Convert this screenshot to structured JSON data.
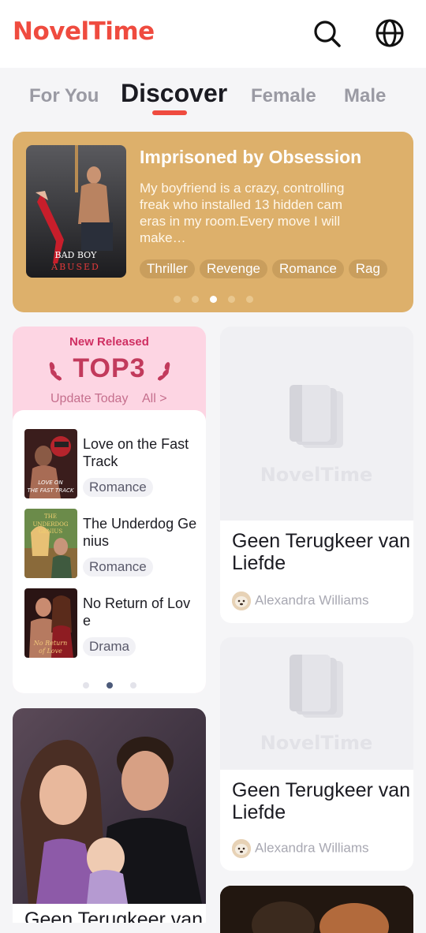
{
  "header": {
    "logo": "NovelTime",
    "search_icon": "search-icon",
    "language_icon": "globe-icon"
  },
  "tabs": [
    {
      "label": "For You"
    },
    {
      "label": "Discover"
    },
    {
      "label": "Female"
    },
    {
      "label": "Male"
    }
  ],
  "banner": {
    "title": "Imprisoned by Obsession",
    "description": "My boyfriend is a crazy, controlling freak who installed 13 hidden cam eras in my room.Every move I will make…",
    "cover_text_1": "BAD BOY",
    "cover_text_2": "ABUSED",
    "tags": [
      "Thriller",
      "Revenge",
      "Romance",
      "Rag"
    ],
    "active_slide": 3,
    "slide_count": 5
  },
  "top3": {
    "label": "New Released",
    "title": "TOP3",
    "update": "Update Today",
    "all": "All >",
    "items": [
      {
        "title": "Love on the Fast Track",
        "tag": "Romance",
        "cover_text": "LOVE ON THE FAST TRACK"
      },
      {
        "title": "The Underdog Genius",
        "tag": "Romance",
        "cover_text": "THE UNDERDOG GENIUS"
      },
      {
        "title": "No Return of Love",
        "tag": "Drama",
        "cover_text": "No Return of Love"
      }
    ],
    "active_page": 2,
    "page_count": 3
  },
  "cards": [
    {
      "title": "Geen Terugkeer van Liefde",
      "author": "Alexandra Williams",
      "placeholder_logo": "NovelTime"
    },
    {
      "title": "Geen Terugkeer van Liefde",
      "author": "Alexandra Williams",
      "placeholder_logo": "NovelTime"
    }
  ],
  "big_card": {
    "title": "Geen Terugkeer van"
  },
  "colors": {
    "brand": "#ef4b3f",
    "banner_bg": "#ddb06b",
    "top3_bg": "#fdd5e3",
    "top3_accent": "#c23a5c"
  }
}
